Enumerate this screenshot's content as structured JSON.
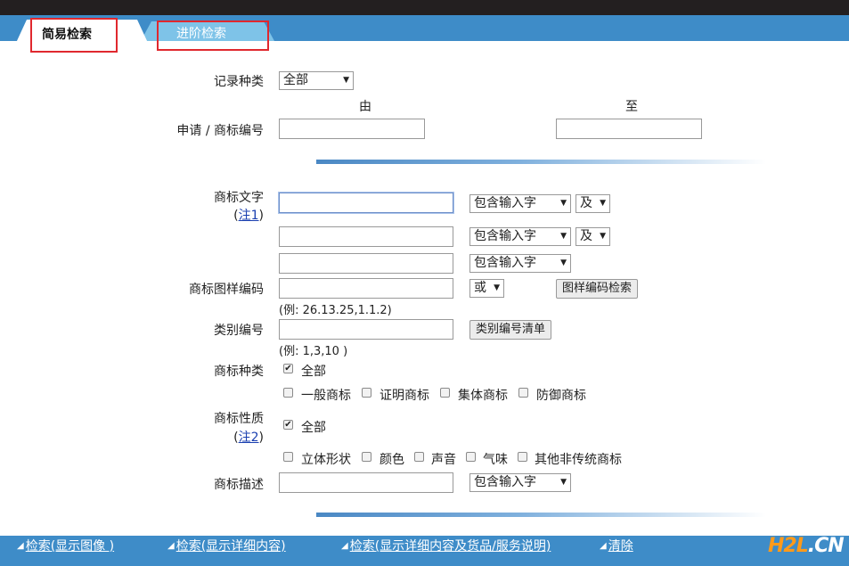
{
  "tabs": [
    {
      "label": "简易检索",
      "active": true
    },
    {
      "label": "进阶检索",
      "active": false
    }
  ],
  "record_type": {
    "label": "记录种类",
    "value": "全部"
  },
  "range": {
    "from": "由",
    "to": "至"
  },
  "app_number": {
    "label": "申请 / 商标编号",
    "from_value": "",
    "to_value": ""
  },
  "mark_text": {
    "label": "商标文字",
    "note_prefix": "(",
    "note_link": "注1",
    "note_suffix": ")",
    "rows": [
      {
        "value": "",
        "match": "包含输入字",
        "op": "及"
      },
      {
        "value": "",
        "match": "包含输入字",
        "op": "及"
      },
      {
        "value": "",
        "match": "包含输入字"
      }
    ]
  },
  "design_code": {
    "label": "商标图样编码",
    "value": "",
    "op": "或",
    "button": "图样编码检索",
    "hint": "(例: 26.13.25,1.1.2)"
  },
  "class_number": {
    "label": "类别编号",
    "value": "",
    "button": "类别编号清单",
    "hint": "(例: 1,3,10 )"
  },
  "mark_kind": {
    "label": "商标种类",
    "all": {
      "label": "全部",
      "checked": true
    },
    "options": [
      {
        "label": "一般商标",
        "checked": false
      },
      {
        "label": "证明商标",
        "checked": false
      },
      {
        "label": "集体商标",
        "checked": false
      },
      {
        "label": "防御商标",
        "checked": false
      }
    ]
  },
  "mark_nature": {
    "label": "商标性质",
    "note_prefix": "(",
    "note_link": "注2",
    "note_suffix": ")",
    "all": {
      "label": "全部",
      "checked": true
    },
    "options": [
      {
        "label": "立体形状",
        "checked": false
      },
      {
        "label": "颜色",
        "checked": false
      },
      {
        "label": "声音",
        "checked": false
      },
      {
        "label": "气味",
        "checked": false
      },
      {
        "label": "其他非传统商标",
        "checked": false
      }
    ]
  },
  "mark_desc": {
    "label": "商标描述",
    "value": "",
    "match": "包含输入字"
  },
  "footer": {
    "links": [
      {
        "label": "检索(显示图像 )"
      },
      {
        "label": "检索(显示详细内容)"
      },
      {
        "label": "检索(显示详细内容及货品/服务说明)"
      },
      {
        "label": "清除"
      }
    ],
    "logo": {
      "part1": "H2L",
      "part2": ".CN"
    }
  },
  "colors": {
    "accent": "#3e8cc8",
    "link": "#1a3fb0",
    "highlight": "#e0282e"
  },
  "icons": {
    "dropdown": "triangle-down-icon",
    "footer_link": "arrow-down-right-icon",
    "check": "checkmark-icon"
  }
}
